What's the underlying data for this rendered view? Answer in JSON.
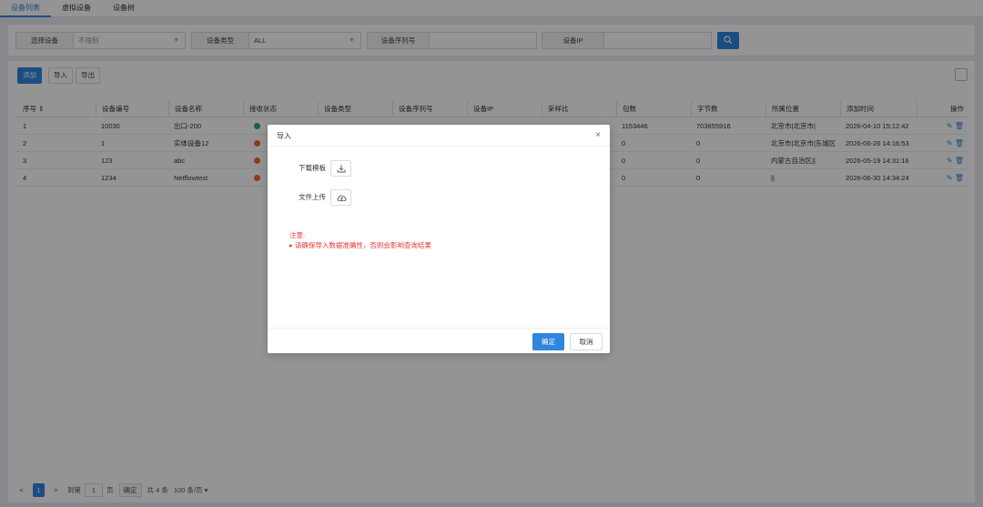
{
  "tabs": [
    "设备列表",
    "虚拟设备",
    "设备树"
  ],
  "filter": {
    "device_label": "选择设备",
    "device_value": "不限制",
    "type_label": "设备类型",
    "type_value": "ALL",
    "serial_label": "设备序列号",
    "serial_value": "",
    "ip_label": "设备IP",
    "ip_value": ""
  },
  "toolbar": {
    "add": "添加",
    "import": "导入",
    "export": "导出"
  },
  "table": {
    "headers": [
      "序号",
      "设备编号",
      "设备名称",
      "接收状态",
      "设备类型",
      "设备序列号",
      "设备IP",
      "采样比",
      "包数",
      "字节数",
      "所属位置",
      "添加时间",
      "操作"
    ],
    "rows": [
      {
        "no": "1",
        "code": "10030",
        "name": "出口-200",
        "status_color": "#2eaa6a",
        "packets": "1153446",
        "bytes": "703655916",
        "location": "北京市|北京市|",
        "time": "2026-04-10 15:12:42"
      },
      {
        "no": "2",
        "code": "1",
        "name": "实体设备12",
        "status_color": "#f0642d",
        "packets": "0",
        "bytes": "0",
        "location": "北京市|北京市|东城区",
        "time": "2026-06-26 14:16:53"
      },
      {
        "no": "3",
        "code": "123",
        "name": "abc",
        "status_color": "#f0642d",
        "packets": "0",
        "bytes": "0",
        "location": "内蒙古自治区||",
        "time": "2026-05-19 14:31:16"
      },
      {
        "no": "4",
        "code": "1234",
        "name": "Netflowtest",
        "status_color": "#f0642d",
        "packets": "0",
        "bytes": "0",
        "location": "||",
        "time": "2026-06-30 14:34:24"
      }
    ],
    "actions": "✎ 🗑"
  },
  "pager": {
    "prev": "<",
    "page": "1",
    "next": ">",
    "goto": "到第",
    "input": "1",
    "unit": "页",
    "confirm": "确定",
    "total": "共 4 条",
    "size": "100 条/页"
  },
  "modal": {
    "title": "导入",
    "close": "×",
    "download_label": "下载模板",
    "upload_label": "文件上传",
    "note_title": "注意:",
    "note_text": "请确保导入数据准确性，否则会影响查询结果",
    "ok": "确定",
    "cancel": "取消"
  }
}
